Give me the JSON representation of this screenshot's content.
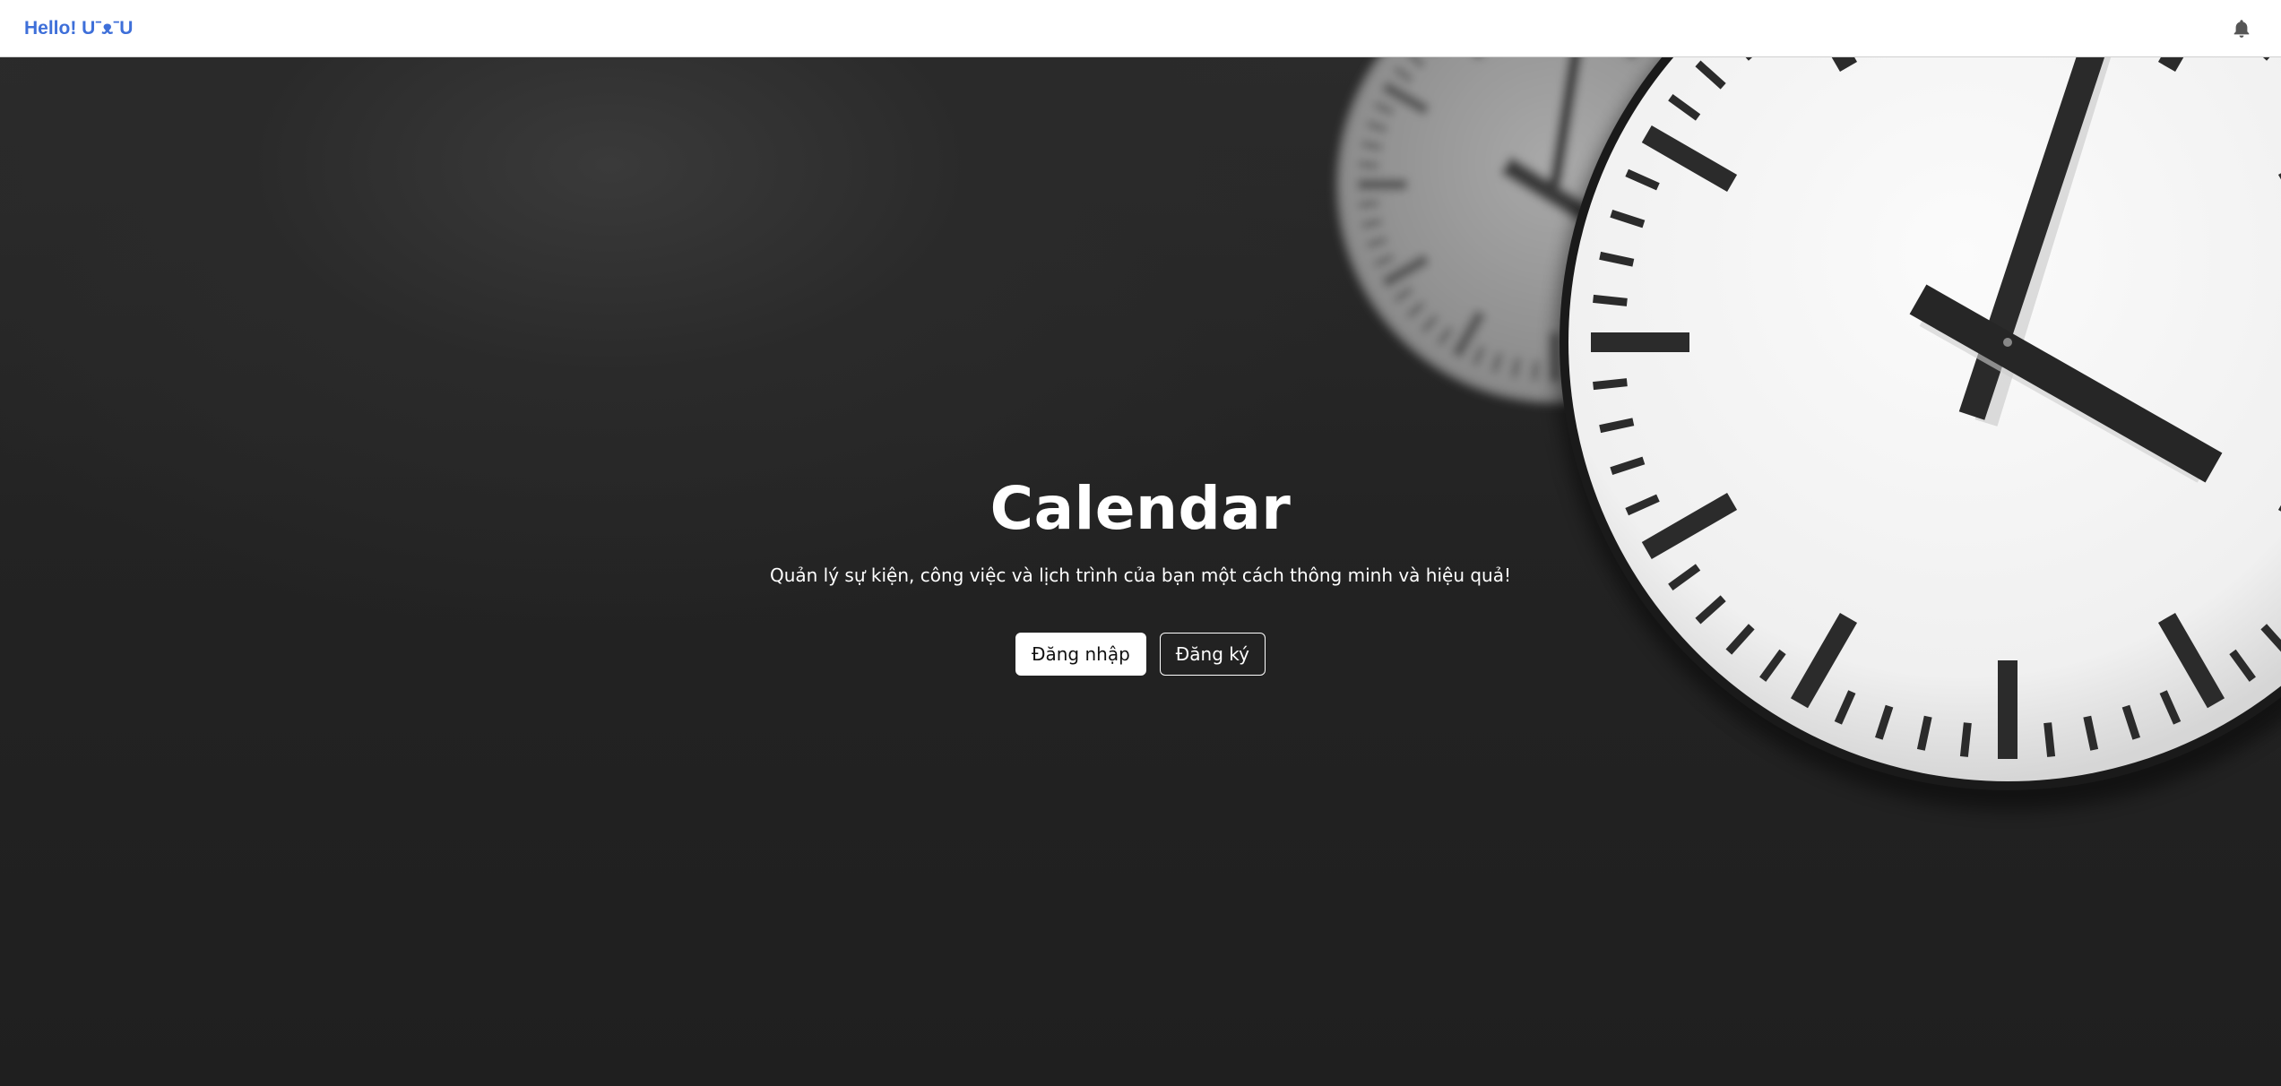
{
  "navbar": {
    "brand": "Hello! UˉᴥˉU"
  },
  "icons": {
    "notifications": "bell-icon"
  },
  "hero": {
    "title": "Calendar",
    "subtitle": "Quản lý sự kiện, công việc và lịch trình của bạn một cách thông minh và hiệu quả!",
    "login_label": "Đăng nhập",
    "register_label": "Đăng ký"
  },
  "colors": {
    "brand": "#3e6fd9",
    "background": "#1e1e1e",
    "text": "#ffffff"
  }
}
